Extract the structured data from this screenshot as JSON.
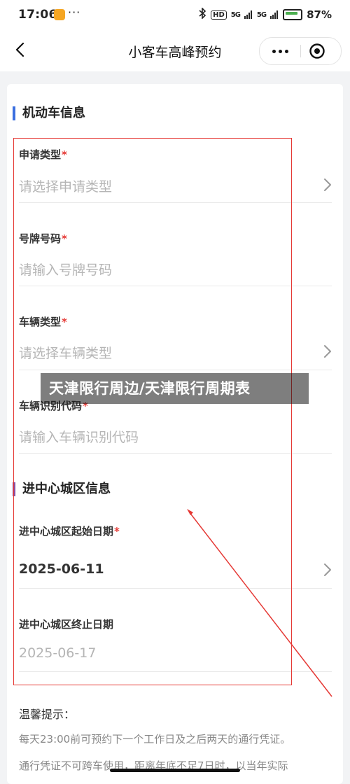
{
  "status_bar": {
    "time": "17:06",
    "notification_icons": "···",
    "hd_label": "HD",
    "signal_labels": [
      "5G",
      "5G"
    ],
    "battery_text": "87%"
  },
  "nav": {
    "title": "小客车高峰预约",
    "back_icon": "chevron-left-icon",
    "more_icon": "more-dots-icon",
    "close_icon": "target-close-icon"
  },
  "form": {
    "vehicle_section_title": "机动车信息",
    "fields": [
      {
        "label": "申请类型",
        "required_mark": "*",
        "placeholder": "请选择申请类型",
        "type": "select"
      },
      {
        "label": "号牌号码",
        "required_mark": "*",
        "placeholder": "请输入号牌号码",
        "type": "input"
      },
      {
        "label": "车辆类型",
        "required_mark": "*",
        "placeholder": "请选择车辆类型",
        "type": "select"
      },
      {
        "label": "车辆识别代码",
        "required_mark": "*",
        "placeholder": "请输入车辆识别代码",
        "type": "input"
      }
    ],
    "city_section_title": "进中心城区信息",
    "start_date": {
      "label": "进中心城区起始日期",
      "required_mark": "*",
      "value": "2025-06-11"
    },
    "end_date": {
      "label": "进中心城区终止日期",
      "value": "2025-06-17"
    }
  },
  "watermark_text": "天津限行周边/天津限行周期表",
  "tips": {
    "title": "温馨提示：",
    "line1": "每天23:00前可预约下一个工作日及之后两天的通行凭证。",
    "line2": "通行凭证不可跨车使用，距离年底不足7日时，以当年实际"
  },
  "colors": {
    "accent_blue": "#3b6fe0",
    "accent_purple": "#8a4fa3",
    "required_red": "#e53935",
    "annotation_red": "#e53935"
  }
}
